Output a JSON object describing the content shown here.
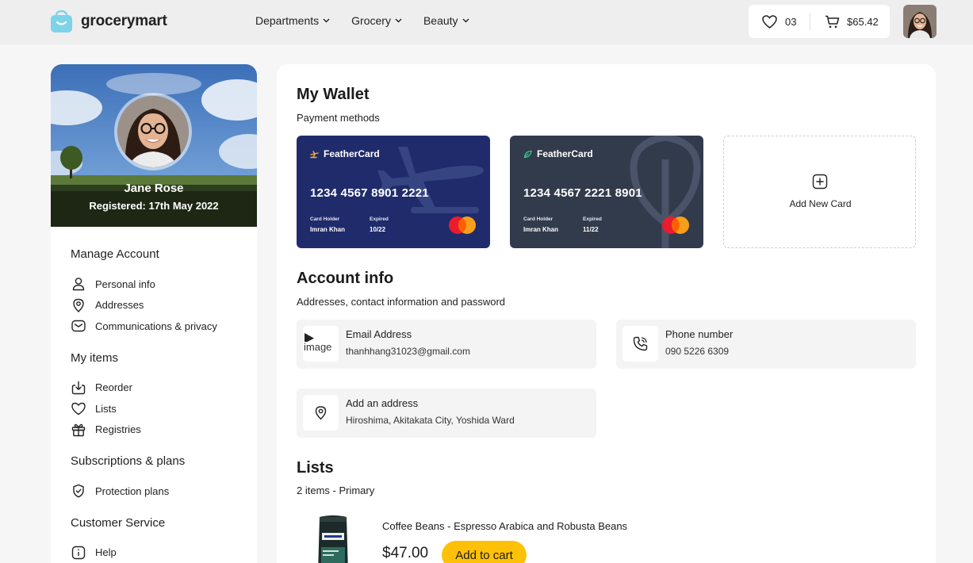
{
  "header": {
    "brand": "grocerymart",
    "nav": [
      {
        "label": "Departments"
      },
      {
        "label": "Grocery"
      },
      {
        "label": "Beauty"
      }
    ],
    "favorites_count": "03",
    "cart_total": "$65.42"
  },
  "profile": {
    "name": "Jane Rose",
    "registered": "Registered: 17th May 2022"
  },
  "sidebar": {
    "groups": [
      {
        "title": "Manage Account",
        "items": [
          {
            "label": "Personal info",
            "icon": "user-icon"
          },
          {
            "label": "Addresses",
            "icon": "location-pin-icon"
          },
          {
            "label": "Communications & privacy",
            "icon": "mail-icon"
          }
        ]
      },
      {
        "title": "My items",
        "items": [
          {
            "label": "Reorder",
            "icon": "download-icon"
          },
          {
            "label": "Lists",
            "icon": "heart-icon"
          },
          {
            "label": "Registries",
            "icon": "gift-icon"
          }
        ]
      },
      {
        "title": "Subscriptions & plans",
        "items": [
          {
            "label": "Protection plans",
            "icon": "shield-icon"
          }
        ]
      },
      {
        "title": "Customer Service",
        "items": [
          {
            "label": "Help",
            "icon": "help-icon"
          }
        ]
      }
    ]
  },
  "wallet": {
    "title": "My Wallet",
    "subtitle": "Payment methods",
    "cards": [
      {
        "brand": "FeatherCard",
        "number": "1234 4567 8901 2221",
        "holder_label": "Card Holder",
        "holder": "Imran Khan",
        "expired_label": "Expired",
        "expired": "10/22",
        "color": "#1f2b6b"
      },
      {
        "brand": "FeatherCard",
        "number": "1234 4567 2221 8901",
        "holder_label": "Card Holder",
        "holder": "Imran Khan",
        "expired_label": "Expired",
        "expired": "11/22",
        "color": "#323b4c"
      }
    ],
    "add_card_label": "Add New Card"
  },
  "account": {
    "title": "Account info",
    "subtitle": "Addresses, contact information and password",
    "email_label": "Email Address",
    "email": "thanhhang31023@gmail.com",
    "email_icon_alt": "image",
    "phone_label": "Phone number",
    "phone": "090 5226 6309",
    "address_label": "Add an address",
    "address": "Hiroshima, Akitakata City, Yoshida Ward"
  },
  "lists": {
    "title": "Lists",
    "subtitle": "2 items - Primary",
    "items": [
      {
        "name": "Coffee Beans - Espresso Arabica and Robusta Beans",
        "price": "$47.00",
        "button": "Add to cart"
      }
    ]
  },
  "colors": {
    "accent": "#ffc107",
    "card_primary": "#1f2b6b",
    "card_secondary": "#323b4c",
    "logo": "#7dd3e8"
  }
}
